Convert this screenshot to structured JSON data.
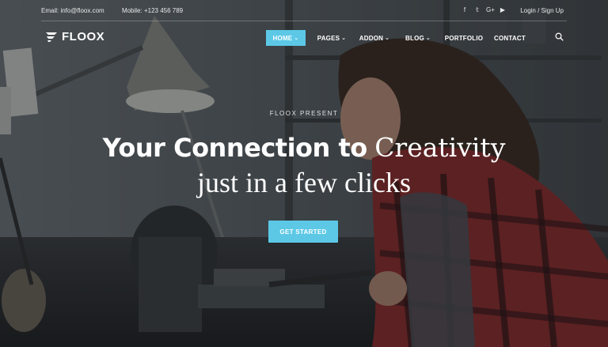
{
  "topbar": {
    "email": "Email: info@floox.com",
    "mobile": "Mobile: +123 456 789",
    "social_icons": [
      "facebook-icon",
      "twitter-icon",
      "google-plus-icon",
      "youtube-icon"
    ],
    "social_glyphs": {
      "facebook": "f",
      "twitter": "𝕥",
      "google": "G+",
      "youtube": "▶"
    },
    "auth": "Login / Sign Up"
  },
  "brand": {
    "name": "FLOOX"
  },
  "nav": {
    "items": [
      {
        "label": "HOME",
        "has_dropdown": true,
        "active": true
      },
      {
        "label": "PAGES",
        "has_dropdown": true
      },
      {
        "label": "ADDON",
        "has_dropdown": true
      },
      {
        "label": "BLOG",
        "has_dropdown": true
      },
      {
        "label": "PORTFOLIO",
        "has_dropdown": false
      },
      {
        "label": "CONTACT",
        "has_dropdown": false
      }
    ],
    "chevron": "⌄",
    "search_icon": "search-icon"
  },
  "hero": {
    "eyebrow": "FLOOX PRESENT",
    "headline_bold": "Your Connection to",
    "headline_serif": "Creativity",
    "subline": "just in a few clicks",
    "cta_label": "GET STARTED"
  },
  "colors": {
    "accent": "#5cc8e6",
    "text": "#ffffff"
  }
}
